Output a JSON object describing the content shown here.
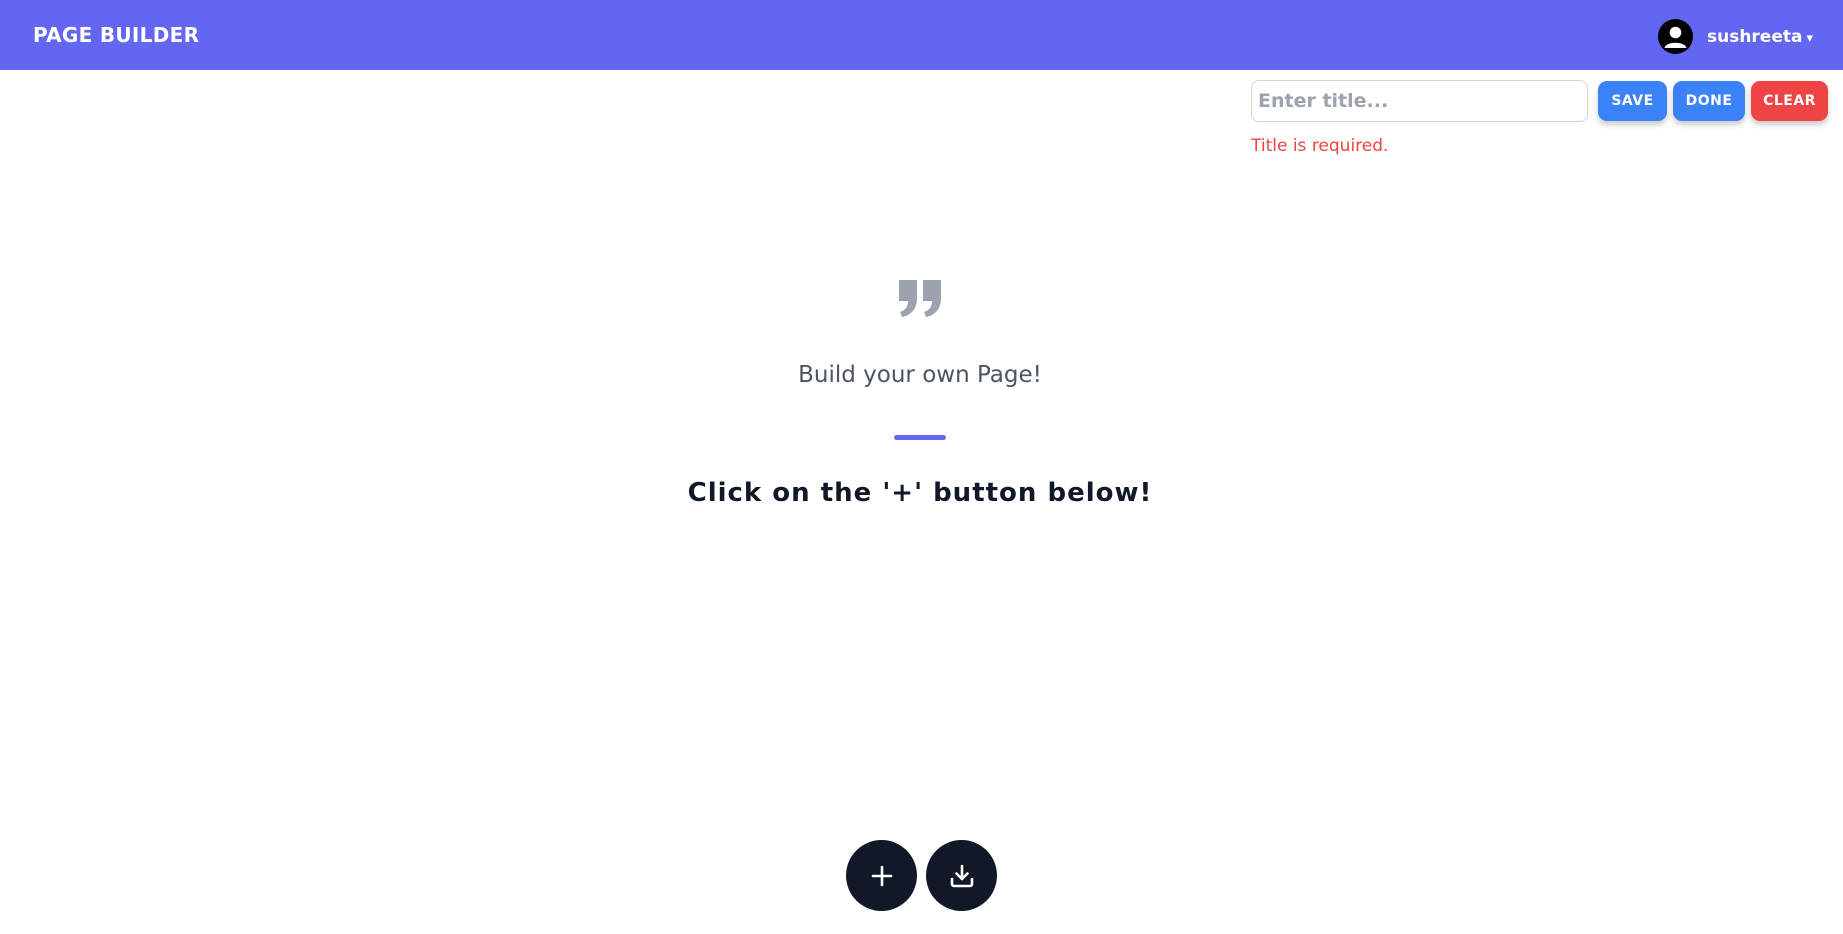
{
  "header": {
    "brand": "PAGE BUILDER",
    "username": "sushreeta",
    "caret": "▾",
    "background_color": "#6366f1"
  },
  "toolbar": {
    "title_placeholder": "Enter title...",
    "title_value": "",
    "save_label": "SAVE",
    "done_label": "DONE",
    "clear_label": "CLEAR",
    "error_message": "Title is required."
  },
  "main": {
    "tagline": "Build your own Page!",
    "instruction": "Click on the '+' button below!"
  },
  "fabs": {
    "add_icon": "plus-icon",
    "download_icon": "download-icon"
  },
  "colors": {
    "primary": "#6366f1",
    "button_blue": "#3b82f6",
    "button_red": "#ef4444",
    "dark": "#111827"
  }
}
